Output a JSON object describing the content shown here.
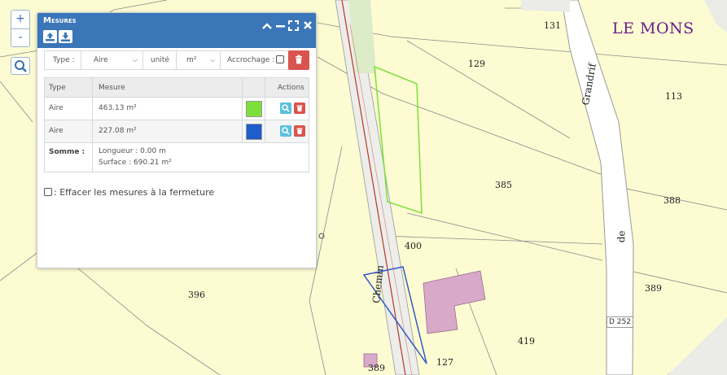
{
  "map": {
    "place_name": "LE MONS",
    "parcels": [
      "131",
      "129",
      "113",
      "385",
      "388",
      "400",
      "396",
      "389",
      "419",
      "127",
      "389"
    ],
    "roads": {
      "road_a": "Grandrif",
      "road_b": "de",
      "road_c": "Chemin",
      "route_badge": "D 252"
    },
    "colors": {
      "background": "#fdfbd2",
      "measure_area_1": "#7be03a",
      "measure_area_2": "#2e5bc7",
      "building": "#d9a9c9"
    }
  },
  "controls": {
    "zoom_in": "+",
    "zoom_out": "-",
    "search_icon": "search-icon"
  },
  "panel": {
    "title": "Mesures",
    "toolbar": {
      "type_label": "Type :",
      "type_value": "Aire",
      "unit_label": "unité",
      "unit_value": "m²",
      "snap_label": "Accrochage :"
    },
    "table": {
      "headers": {
        "type": "Type",
        "measure": "Mesure",
        "actions": "Actions"
      },
      "rows": [
        {
          "type": "Aire",
          "measure": "463.13 m²",
          "color": "#7be03a"
        },
        {
          "type": "Aire",
          "measure": "227.08 m²",
          "color": "#1f5ccc"
        }
      ],
      "sum": {
        "label": "Somme :",
        "length": "Longueur : 0.00 m",
        "surface": "Surface : 690.21 m²"
      }
    },
    "clear_option": ": Effacer les mesures à la fermeture"
  }
}
